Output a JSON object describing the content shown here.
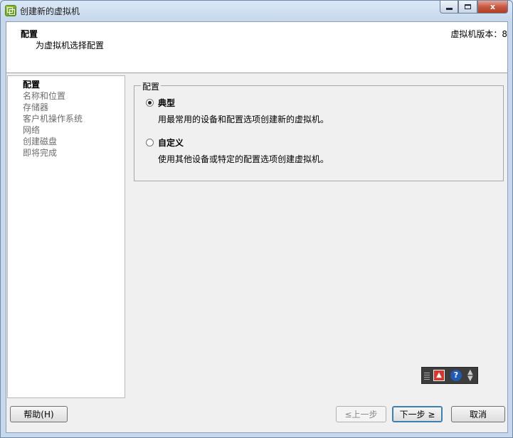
{
  "window": {
    "title": "创建新的虚拟机",
    "controls": {
      "close_label": "x"
    }
  },
  "header": {
    "title": "配置",
    "subtitle": "为虚拟机选择配置",
    "version": "虚拟机版本：8"
  },
  "nav": {
    "items": [
      {
        "label": "配置",
        "active": true
      },
      {
        "label": "名称和位置"
      },
      {
        "label": "存储器"
      },
      {
        "label": "客户机操作系统"
      },
      {
        "label": "网络"
      },
      {
        "label": "创建磁盘"
      },
      {
        "label": "即将完成"
      }
    ]
  },
  "config": {
    "group_label": "配置",
    "options": [
      {
        "label": "典型",
        "description": "用最常用的设备和配置选项创建新的虚拟机。",
        "selected": true
      },
      {
        "label": "自定义",
        "description": "使用其他设备或特定的配置选项创建虚拟机。",
        "selected": false
      }
    ]
  },
  "widget": {
    "question": "?"
  },
  "buttons": {
    "help": "帮助(H)",
    "back": "≤上一步",
    "next": "下一步 ≥",
    "cancel": "取消"
  }
}
